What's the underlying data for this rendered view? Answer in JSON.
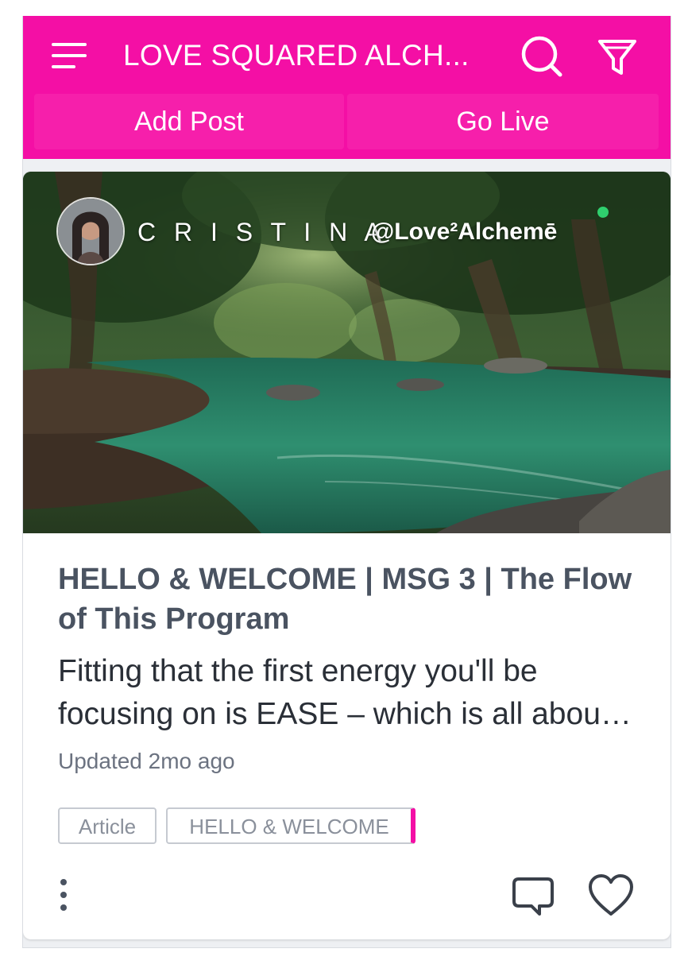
{
  "header": {
    "title": "LOVE SQUARED ALCH...",
    "menu_icon": "hamburger-menu-icon",
    "search_icon": "search-icon",
    "filter_icon": "filter-icon",
    "add_post_label": "Add Post",
    "go_live_label": "Go Live",
    "accent_color": "#f40fa5"
  },
  "post": {
    "author_name": "C R I S T I N A",
    "author_handle": "@Love²Alchemē",
    "online_status_color": "#2fd06e",
    "title": "HELLO & WELCOME | MSG 3 | The Flow of This Program",
    "excerpt": "Fitting that the first energy you'll be focusing on is EASE – which is all about accepting and flowing with what is.",
    "updated": "Updated 2mo ago",
    "tags": [
      "Article",
      "HELLO & WELCOME"
    ],
    "more_icon": "more-vertical-icon",
    "comment_icon": "comment-icon",
    "like_icon": "heart-icon"
  }
}
